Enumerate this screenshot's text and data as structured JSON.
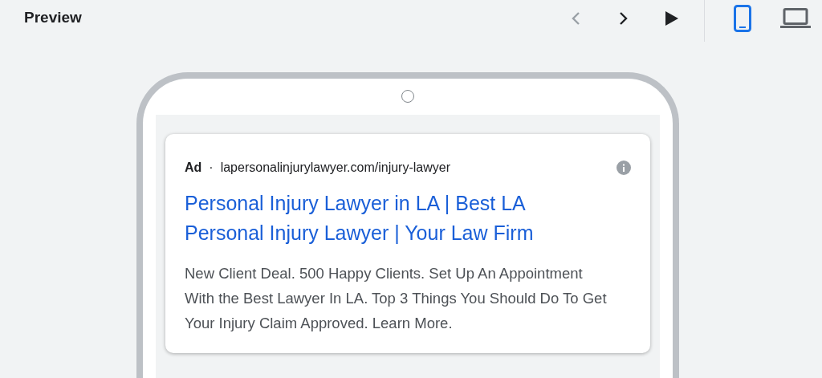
{
  "header": {
    "title": "Preview"
  },
  "nav": [
    {
      "kind": "previous",
      "disabled": true
    },
    {
      "kind": "next",
      "disabled": false
    },
    {
      "kind": "play",
      "disabled": false
    }
  ],
  "devices": [
    {
      "kind": "mobile",
      "selected": true
    },
    {
      "kind": "desktop",
      "selected": false
    }
  ],
  "ad": {
    "label": "Ad",
    "separator": "·",
    "url": "lapersonalinjurylawyer.com/injury-lawyer",
    "headline": "Personal Injury Lawyer in LA | Best LA Personal Injury Lawyer | Your Law Firm",
    "description": "New Client Deal. 500 Happy Clients. Set Up An Appointment With the Best Lawyer In LA. Top 3 Things You Should Do To Get Your Injury Claim Approved. Learn More."
  }
}
